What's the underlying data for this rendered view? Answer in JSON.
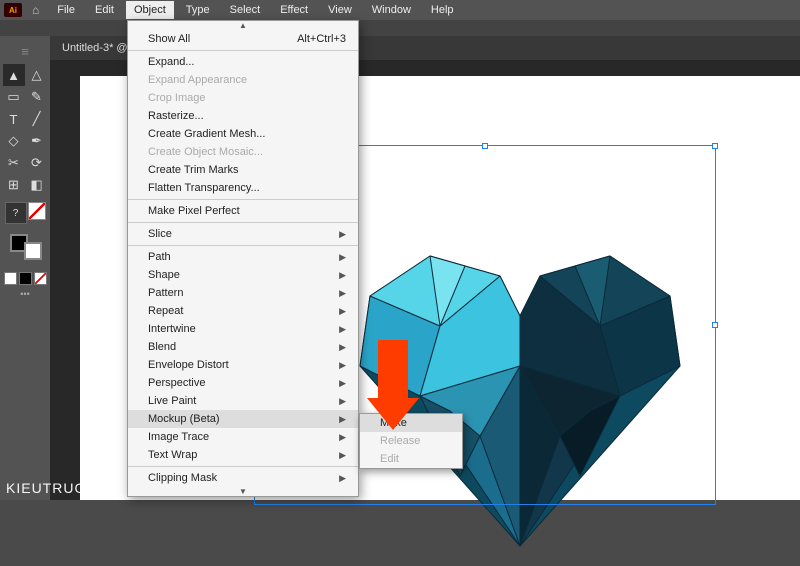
{
  "menubar": {
    "logo_text": "Ai",
    "items": [
      "File",
      "Edit",
      "Object",
      "Type",
      "Select",
      "Effect",
      "View",
      "Window",
      "Help"
    ],
    "active_index": 2
  },
  "document": {
    "tab_label": "Untitled-3* @"
  },
  "dropdown": {
    "items": [
      {
        "label": "Show All",
        "shortcut": "Alt+Ctrl+3",
        "disabled": false,
        "submenu": false,
        "sep_after": true
      },
      {
        "label": "Expand...",
        "disabled": false,
        "submenu": false
      },
      {
        "label": "Expand Appearance",
        "disabled": true,
        "submenu": false
      },
      {
        "label": "Crop Image",
        "disabled": true,
        "submenu": false
      },
      {
        "label": "Rasterize...",
        "disabled": false,
        "submenu": false
      },
      {
        "label": "Create Gradient Mesh...",
        "disabled": false,
        "submenu": false
      },
      {
        "label": "Create Object Mosaic...",
        "disabled": true,
        "submenu": false
      },
      {
        "label": "Create Trim Marks",
        "disabled": false,
        "submenu": false
      },
      {
        "label": "Flatten Transparency...",
        "disabled": false,
        "submenu": false,
        "sep_after": true
      },
      {
        "label": "Make Pixel Perfect",
        "disabled": false,
        "submenu": false,
        "sep_after": true
      },
      {
        "label": "Slice",
        "disabled": false,
        "submenu": true,
        "sep_after": true
      },
      {
        "label": "Path",
        "disabled": false,
        "submenu": true
      },
      {
        "label": "Shape",
        "disabled": false,
        "submenu": true
      },
      {
        "label": "Pattern",
        "disabled": false,
        "submenu": true
      },
      {
        "label": "Repeat",
        "disabled": false,
        "submenu": true
      },
      {
        "label": "Intertwine",
        "disabled": false,
        "submenu": true
      },
      {
        "label": "Blend",
        "disabled": false,
        "submenu": true
      },
      {
        "label": "Envelope Distort",
        "disabled": false,
        "submenu": true
      },
      {
        "label": "Perspective",
        "disabled": false,
        "submenu": true
      },
      {
        "label": "Live Paint",
        "disabled": false,
        "submenu": true
      },
      {
        "label": "Mockup (Beta)",
        "disabled": false,
        "submenu": true,
        "highlight": true
      },
      {
        "label": "Image Trace",
        "disabled": false,
        "submenu": true
      },
      {
        "label": "Text Wrap",
        "disabled": false,
        "submenu": true,
        "sep_after": true
      },
      {
        "label": "Clipping Mask",
        "disabled": false,
        "submenu": true
      }
    ]
  },
  "submenu": {
    "items": [
      {
        "label": "Make",
        "disabled": false,
        "highlight": true
      },
      {
        "label": "Release",
        "disabled": true
      },
      {
        "label": "Edit",
        "disabled": true
      }
    ]
  },
  "watermark": "KIEUTRUONG.COM",
  "tools": {
    "glyphs": [
      "▸",
      "▹",
      "▭",
      "✎",
      "T",
      "╱",
      "▢",
      "✶",
      "✂",
      "⟳",
      "✦",
      "◧"
    ]
  }
}
